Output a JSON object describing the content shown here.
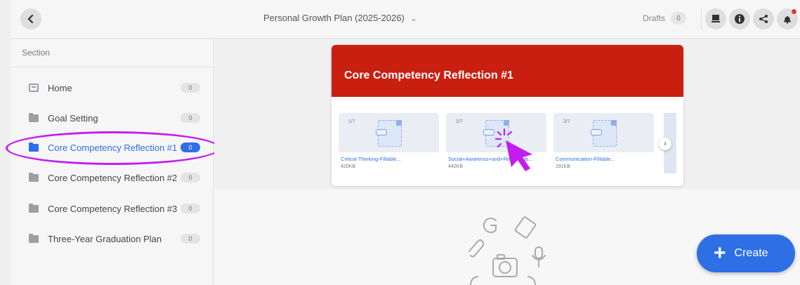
{
  "header": {
    "title": "Personal Growth Plan (2025-2026)",
    "drafts_label": "Drafts",
    "drafts_count": "0"
  },
  "sidebar": {
    "header": "Section",
    "items": [
      {
        "label": "Home",
        "count": "0",
        "icon": "home-icon"
      },
      {
        "label": "Goal Setting",
        "count": "0",
        "icon": "folder-icon"
      },
      {
        "label": "Core Competency Reflection #1",
        "count": "0",
        "icon": "folder-icon",
        "active": true
      },
      {
        "label": "Core Competency Reflection #2",
        "count": "0",
        "icon": "folder-icon"
      },
      {
        "label": "Core Competency Reflection #3",
        "count": "0",
        "icon": "folder-icon"
      },
      {
        "label": "Three-Year Graduation Plan",
        "count": "0",
        "icon": "folder-icon"
      }
    ]
  },
  "card": {
    "title": "Core Competency Reflection #1",
    "files": [
      {
        "index": "1/7",
        "name": "Critical Thinking-Fillable...",
        "size": "420KB"
      },
      {
        "index": "2/7",
        "name": "Social+Awarenss+and+Responsib...",
        "size": "442KB"
      },
      {
        "index": "3/7",
        "name": "Communication-Fillable...",
        "size": "291KB"
      }
    ]
  },
  "create_label": "Create",
  "colors": {
    "accent": "#2f6fe6",
    "card_header": "#c91f10",
    "highlight": "#c41cf0"
  }
}
